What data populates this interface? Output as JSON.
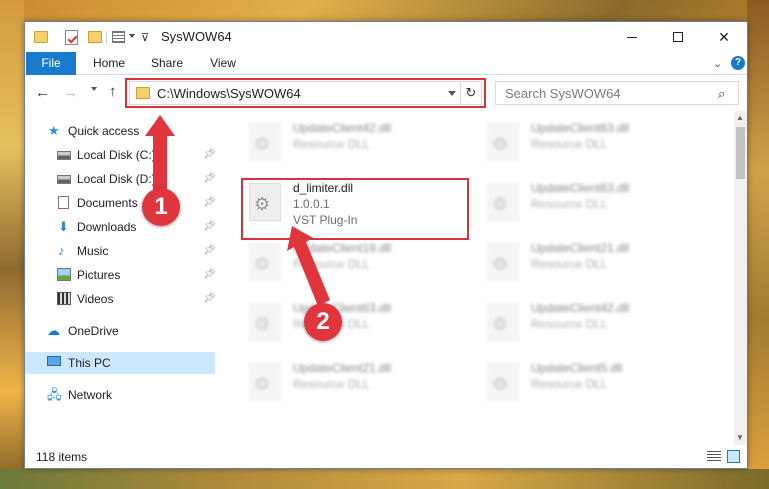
{
  "window": {
    "title": "SysWOW64",
    "controls": {
      "minimize": "–",
      "maximize": "□",
      "close": "✕"
    }
  },
  "ribbon": {
    "tabs": [
      "File",
      "Home",
      "Share",
      "View"
    ],
    "help": "?"
  },
  "address": {
    "path": "C:\\Windows\\SysWOW64",
    "search_placeholder": "Search SysWOW64"
  },
  "sidebar": {
    "quick_access": "Quick access",
    "items": [
      {
        "label": "Local Disk (C:)",
        "icon": "disk-icon"
      },
      {
        "label": "Local Disk (D:)",
        "icon": "disk-icon"
      },
      {
        "label": "Documents",
        "icon": "documents-icon"
      },
      {
        "label": "Downloads",
        "icon": "downloads-icon"
      },
      {
        "label": "Music",
        "icon": "music-icon"
      },
      {
        "label": "Pictures",
        "icon": "pictures-icon"
      },
      {
        "label": "Videos",
        "icon": "videos-icon"
      }
    ],
    "onedrive": "OneDrive",
    "this_pc": "This PC",
    "network": "Network"
  },
  "files": {
    "left_col": [
      {
        "name": "UpdateClient42.dll",
        "desc": "Resource DLL"
      },
      {
        "name": "d_limiter.dll",
        "desc": "1.0.0.1",
        "extra": "VST Plug-In"
      },
      {
        "name": "UpdateClient19.dll",
        "desc": "Resource DLL"
      },
      {
        "name": "UpdateClient63.dll",
        "desc": "Resource DLL"
      },
      {
        "name": "UpdateClient21.dll",
        "desc": "Resource DLL"
      }
    ],
    "right_col": [
      {
        "name": "UpdateClient63.dll",
        "desc": "Resource DLL"
      },
      {
        "name": "UpdateClient63.dll",
        "desc": "Resource DLL"
      },
      {
        "name": "UpdateClient21.dll",
        "desc": "Resource DLL"
      },
      {
        "name": "UpdateClient42.dll",
        "desc": "Resource DLL"
      },
      {
        "name": "UpdateClient5.dll",
        "desc": "Resource DLL"
      }
    ]
  },
  "status": {
    "item_count": "118 items"
  },
  "annotations": {
    "step1": "1",
    "step2": "2",
    "color": "#e0353d"
  }
}
